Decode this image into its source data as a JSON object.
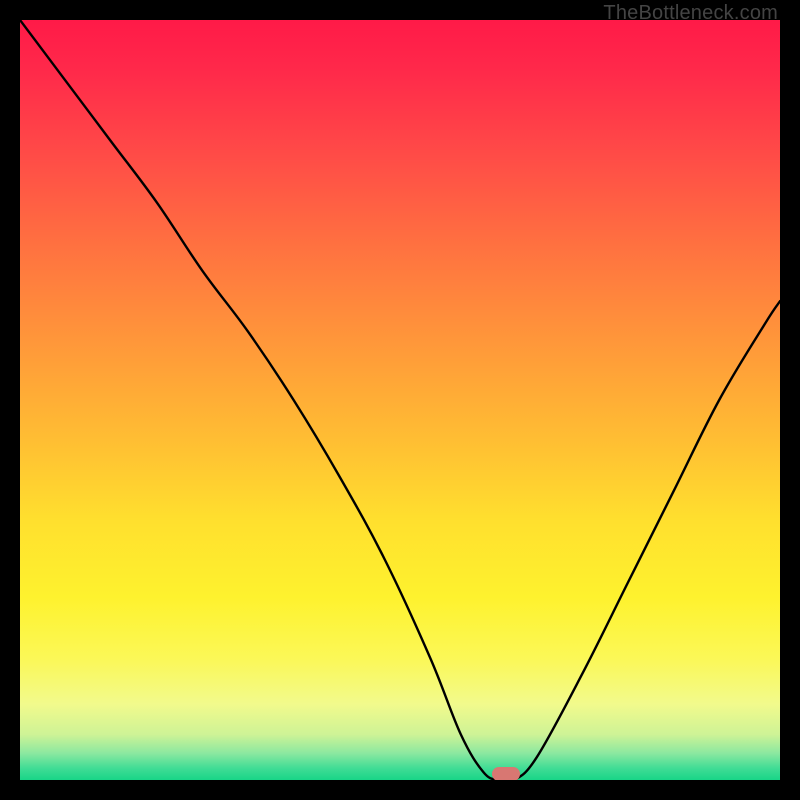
{
  "watermark": "TheBottleneck.com",
  "chart_data": {
    "type": "line",
    "title": "",
    "xlabel": "",
    "ylabel": "",
    "xlim": [
      0,
      100
    ],
    "ylim": [
      0,
      100
    ],
    "series": [
      {
        "name": "bottleneck-curve",
        "x": [
          0,
          6,
          12,
          18,
          24,
          30,
          36,
          42,
          48,
          54,
          58,
          61,
          63,
          65,
          68,
          74,
          80,
          86,
          92,
          98,
          100
        ],
        "y": [
          100,
          92,
          84,
          76,
          67,
          59,
          50,
          40,
          29,
          16,
          6,
          1,
          0,
          0,
          3,
          14,
          26,
          38,
          50,
          60,
          63
        ]
      }
    ],
    "marker": {
      "x": 64,
      "y": 0.8,
      "color": "#d87772"
    },
    "gradient_stops": [
      {
        "pos": 0.0,
        "color": "#ff1a48"
      },
      {
        "pos": 0.07,
        "color": "#ff2a4a"
      },
      {
        "pos": 0.18,
        "color": "#ff4c47"
      },
      {
        "pos": 0.3,
        "color": "#ff7240"
      },
      {
        "pos": 0.42,
        "color": "#ff963a"
      },
      {
        "pos": 0.55,
        "color": "#ffbd33"
      },
      {
        "pos": 0.66,
        "color": "#ffe02e"
      },
      {
        "pos": 0.76,
        "color": "#fef22e"
      },
      {
        "pos": 0.84,
        "color": "#fbf857"
      },
      {
        "pos": 0.9,
        "color": "#f2fa8c"
      },
      {
        "pos": 0.94,
        "color": "#cef396"
      },
      {
        "pos": 0.965,
        "color": "#8be8a0"
      },
      {
        "pos": 0.985,
        "color": "#3fdc95"
      },
      {
        "pos": 1.0,
        "color": "#18d587"
      }
    ]
  }
}
